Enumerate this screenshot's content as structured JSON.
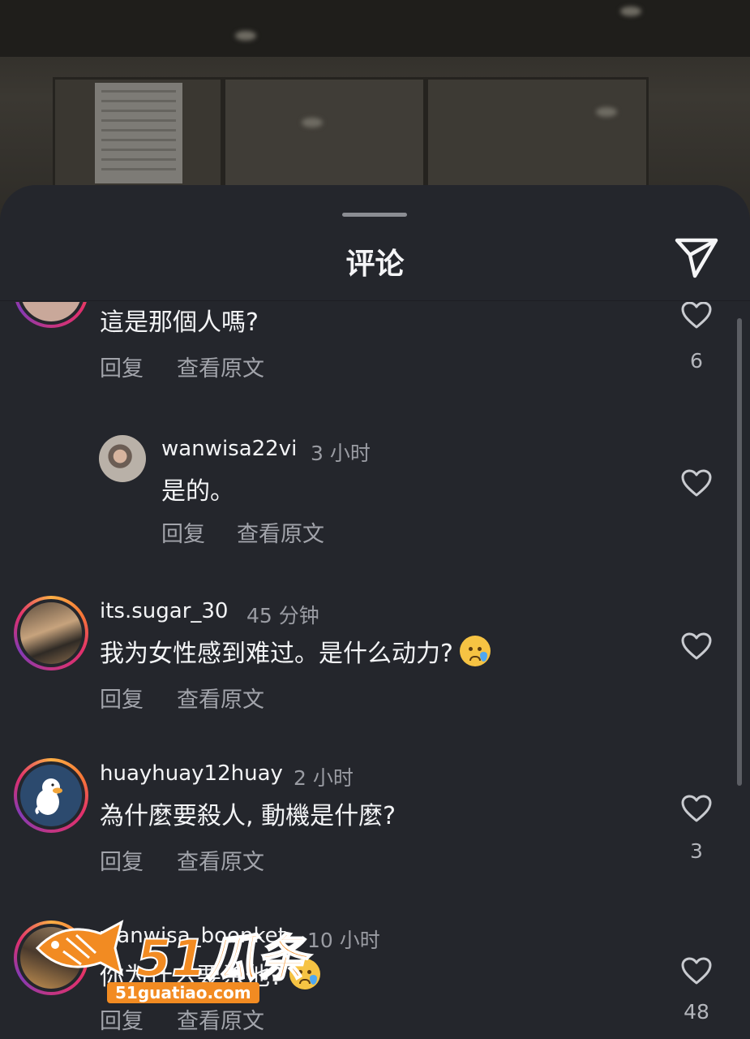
{
  "sheet": {
    "title": "评论"
  },
  "comments": [
    {
      "username": "",
      "time": "",
      "text": "這是那個人嗎?",
      "reply": "回复",
      "translate": "查看原文",
      "likes": "6",
      "emoji": false
    },
    {
      "username": "wanwisa22vi",
      "time": "3 小时",
      "text": "是的。",
      "reply": "回复",
      "translate": "查看原文",
      "likes": "",
      "emoji": false
    },
    {
      "username": "its.sugar_30",
      "time": "45 分钟",
      "text": "我为女性感到难过。是什么动力?",
      "reply": "回复",
      "translate": "查看原文",
      "likes": "",
      "emoji": "crying-face"
    },
    {
      "username": "huayhuay12huay",
      "time": "2 小时",
      "text": "為什麼要殺人, 動機是什麼?",
      "reply": "回复",
      "translate": "查看原文",
      "likes": "3",
      "emoji": false
    },
    {
      "username": "wanwisa_boonket",
      "time": "10 小时",
      "text": "你为什么要杀他?",
      "reply": "回复",
      "translate": "查看原文",
      "likes": "48",
      "emoji": "crying-face"
    }
  ],
  "watermark": {
    "brand": "51瓜条",
    "domain": "51guatiao.com"
  },
  "icons": {
    "send": "send-icon",
    "like": "heart-outline-icon",
    "emoji": "crying-face-emoji"
  },
  "colors": {
    "sheet_bg": "#24262c",
    "text_primary": "#f3f4f6",
    "text_secondary": "#a2a4ab",
    "watermark": "#f28b22"
  }
}
